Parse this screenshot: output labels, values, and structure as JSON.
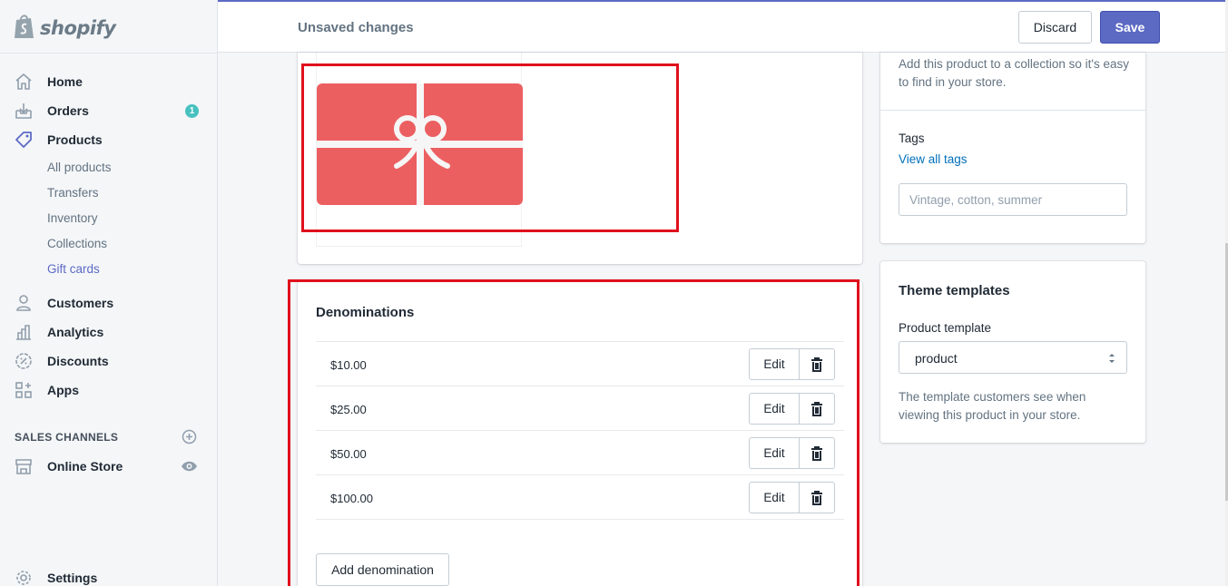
{
  "brand": {
    "name": "shopify"
  },
  "topbar": {
    "status": "Unsaved changes",
    "discard_label": "Discard",
    "save_label": "Save"
  },
  "sidebar": {
    "home": "Home",
    "orders": "Orders",
    "orders_badge": "1",
    "products": "Products",
    "sub": [
      "All products",
      "Transfers",
      "Inventory",
      "Collections",
      "Gift cards"
    ],
    "customers": "Customers",
    "analytics": "Analytics",
    "discounts": "Discounts",
    "apps": "Apps",
    "sales_channels": "SALES CHANNELS",
    "online_store": "Online Store",
    "settings": "Settings"
  },
  "denominations": {
    "title": "Denominations",
    "items": [
      "$10.00",
      "$25.00",
      "$50.00",
      "$100.00"
    ],
    "edit_label": "Edit",
    "add_label": "Add denomination"
  },
  "collections": {
    "help": "Add this product to a collection so it's easy to find in your store."
  },
  "tags": {
    "label": "Tags",
    "view_all": "View all tags",
    "placeholder": "Vintage, cotton, summer"
  },
  "theme": {
    "title": "Theme templates",
    "label": "Product template",
    "selected": "product",
    "help": "The template customers see when viewing this product in your store."
  },
  "colors": {
    "accent": "#5c6ac4",
    "gift_card": "#ec5f61",
    "highlight": "#e0101c",
    "badge": "#47c1bf",
    "link": "#006fbb"
  },
  "icons": [
    "shopify-bag-icon",
    "home-icon",
    "orders-icon",
    "tag-icon",
    "customers-icon",
    "analytics-icon",
    "discounts-icon",
    "apps-icon",
    "add-circle-icon",
    "store-icon",
    "eye-icon",
    "settings-icon",
    "trash-icon",
    "select-arrows-icon"
  ]
}
